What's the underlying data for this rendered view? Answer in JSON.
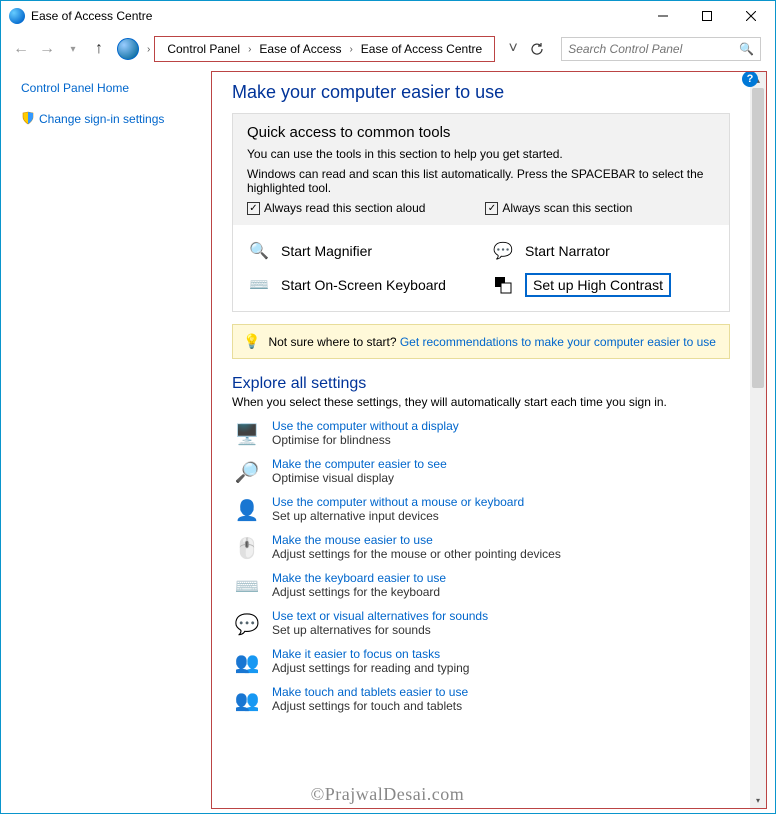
{
  "window": {
    "title": "Ease of Access Centre"
  },
  "breadcrumb": {
    "items": [
      "Control Panel",
      "Ease of Access",
      "Ease of Access Centre"
    ]
  },
  "search": {
    "placeholder": "Search Control Panel"
  },
  "sidebar": {
    "home": "Control Panel Home",
    "signin": "Change sign-in settings"
  },
  "main": {
    "heading": "Make your computer easier to use",
    "quick": {
      "title": "Quick access to common tools",
      "line1": "You can use the tools in this section to help you get started.",
      "line2": "Windows can read and scan this list automatically.  Press the SPACEBAR to select the highlighted tool.",
      "chk1": "Always read this section aloud",
      "chk2": "Always scan this section"
    },
    "tools": {
      "magnifier": "Start Magnifier",
      "narrator": "Start Narrator",
      "osk": "Start On-Screen Keyboard",
      "highcontrast": "Set up High Contrast"
    },
    "hint": {
      "prefix": "Not sure where to start? ",
      "link": "Get recommendations to make your computer easier to use"
    },
    "explore": {
      "title": "Explore all settings",
      "sub": "When you select these settings, they will automatically start each time you sign in.",
      "items": [
        {
          "link": "Use the computer without a display",
          "desc": "Optimise for blindness"
        },
        {
          "link": "Make the computer easier to see",
          "desc": "Optimise visual display"
        },
        {
          "link": "Use the computer without a mouse or keyboard",
          "desc": "Set up alternative input devices"
        },
        {
          "link": "Make the mouse easier to use",
          "desc": "Adjust settings for the mouse or other pointing devices"
        },
        {
          "link": "Make the keyboard easier to use",
          "desc": "Adjust settings for the keyboard"
        },
        {
          "link": "Use text or visual alternatives for sounds",
          "desc": "Set up alternatives for sounds"
        },
        {
          "link": "Make it easier to focus on tasks",
          "desc": "Adjust settings for reading and typing"
        },
        {
          "link": "Make touch and tablets easier to use",
          "desc": "Adjust settings for touch and tablets"
        }
      ]
    }
  },
  "watermark": "©PrajwalDesai.com"
}
